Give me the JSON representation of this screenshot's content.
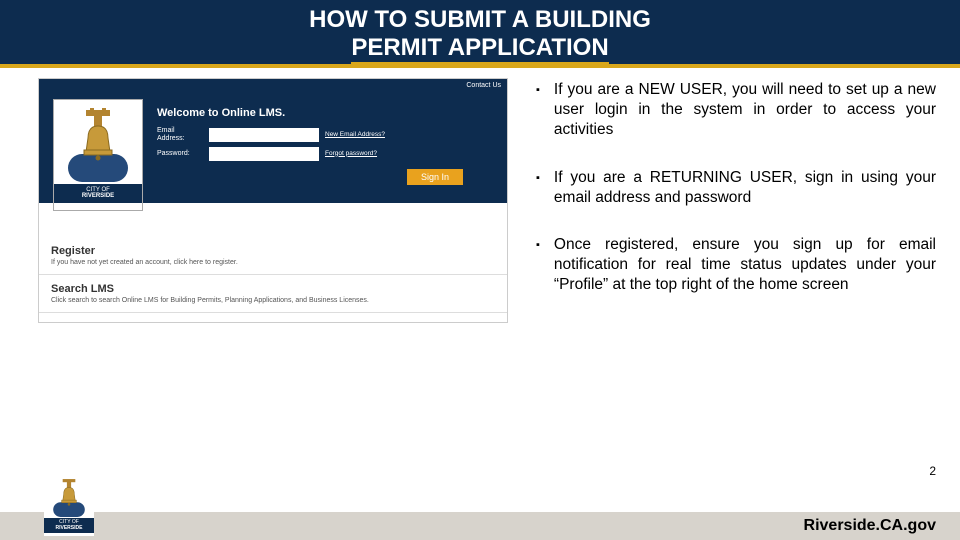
{
  "title": {
    "line1": "HOW TO SUBMIT A BUILDING",
    "line2": "PERMIT APPLICATION"
  },
  "screenshot": {
    "topLink": "Contact Us",
    "welcome": "Welcome to Online LMS.",
    "emailLabel": "Email Address:",
    "passwordLabel": "Password:",
    "link1": "New Email Address?",
    "link2": "Forgot password?",
    "signin": "Sign In",
    "registerHeading": "Register",
    "registerText": "If you have not yet created an account, click here to register.",
    "searchHeading": "Search LMS",
    "searchText": "Click search to search Online LMS for Building Permits, Planning Applications, and Business Licenses.",
    "cityOf": "CITY OF",
    "cityName": "RIVERSIDE"
  },
  "bullets": [
    "If you are a NEW USER, you will need to set up a new user login in the system in order to access your activities",
    "If you are a RETURNING USER, sign in using your email address and password",
    "Once registered, ensure you sign up for email notification for real time status updates under your “Profile” at the top right of the home screen"
  ],
  "pageNumber": "2",
  "footerText": "Riverside.CA.gov"
}
